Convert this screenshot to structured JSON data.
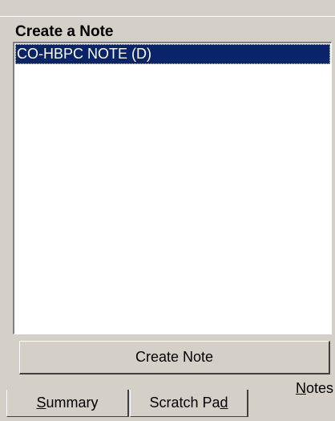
{
  "panel": {
    "title": "Create a Note"
  },
  "note_list": {
    "items": [
      {
        "label": "CO-HBPC NOTE (D)",
        "selected": true
      }
    ]
  },
  "actions": {
    "create_note_label": "Create Note"
  },
  "tabs": [
    {
      "label": "Summary",
      "accelerator": "S",
      "active": false
    },
    {
      "label": "Scratch Pad",
      "accelerator": "d",
      "active": false
    },
    {
      "label": "Notes",
      "accelerator": "N",
      "active": true
    }
  ],
  "colors": {
    "face": "#d4d0c8",
    "selection": "#0a246a",
    "selection_text": "#ffffff"
  }
}
